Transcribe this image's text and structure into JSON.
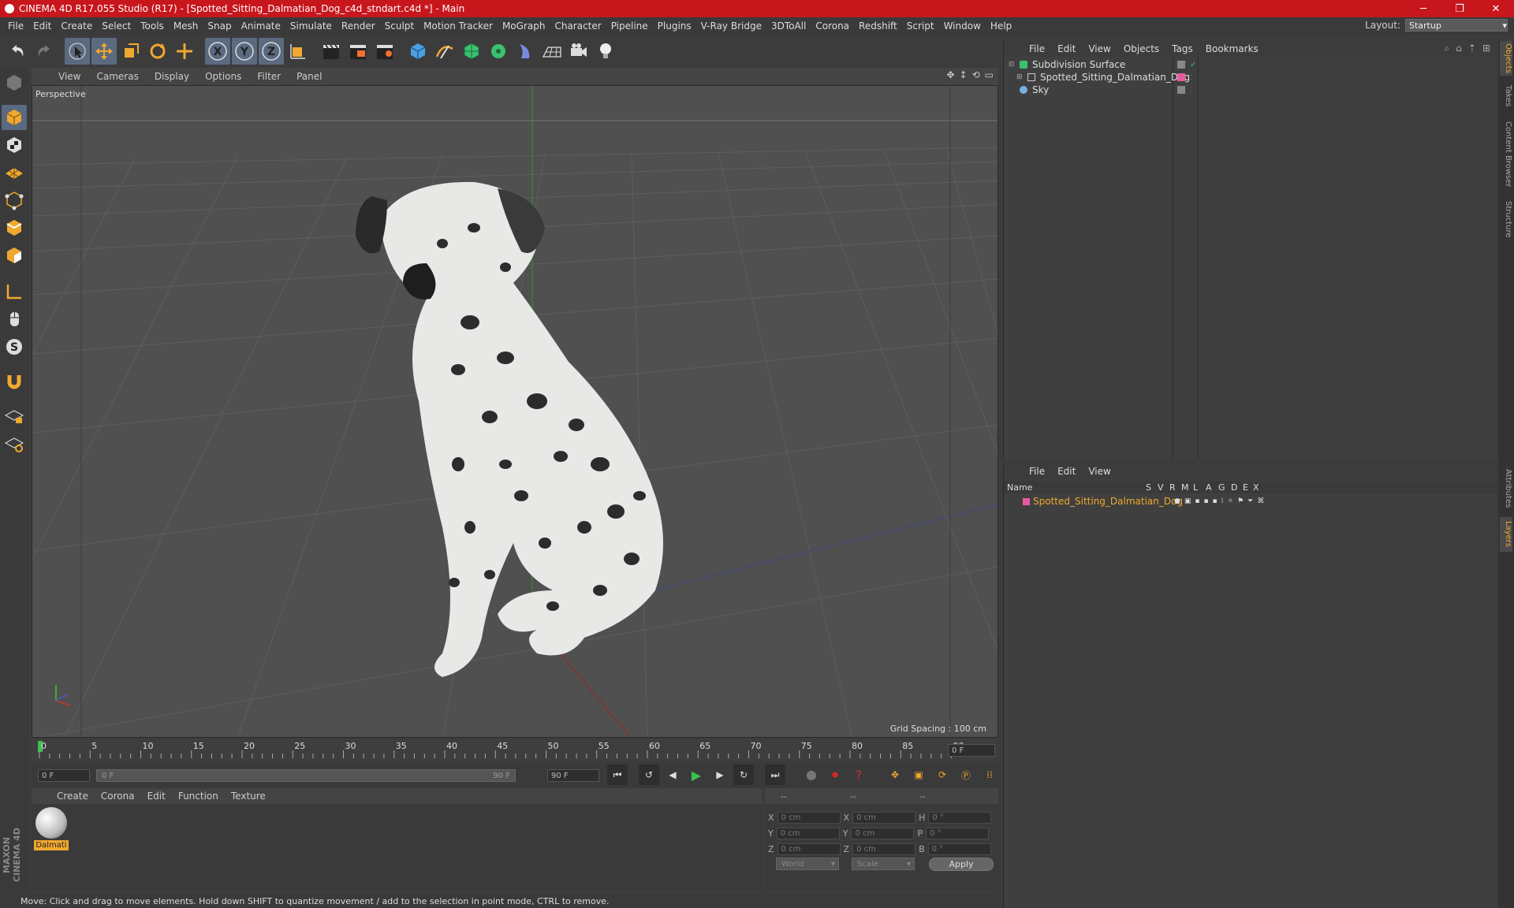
{
  "window": {
    "title": "CINEMA 4D R17.055 Studio (R17) - [Spotted_Sitting_Dalmatian_Dog_c4d_stndart.c4d *] - Main",
    "min": "─",
    "max": "❐",
    "close": "✕"
  },
  "menu": [
    "File",
    "Edit",
    "Create",
    "Select",
    "Tools",
    "Mesh",
    "Snap",
    "Animate",
    "Simulate",
    "Render",
    "Sculpt",
    "Motion Tracker",
    "MoGraph",
    "Character",
    "Pipeline",
    "Plugins",
    "V-Ray Bridge",
    "3DToAll",
    "Corona",
    "Redshift",
    "Script",
    "Window",
    "Help"
  ],
  "layout": {
    "label": "Layout:",
    "value": "Startup"
  },
  "viewport": {
    "menu": [
      "View",
      "Cameras",
      "Display",
      "Options",
      "Filter",
      "Panel"
    ],
    "label": "Perspective",
    "grid_spacing": "Grid Spacing : 100 cm"
  },
  "timeline": {
    "ticks": [
      "0",
      "5",
      "10",
      "15",
      "20",
      "25",
      "30",
      "35",
      "40",
      "45",
      "50",
      "55",
      "60",
      "65",
      "70",
      "75",
      "80",
      "85",
      "90"
    ],
    "end_field": "0 F",
    "start": "0 F",
    "range_start": "0 F",
    "range_end": "90 F",
    "max": "90 F"
  },
  "material_menu": [
    "Create",
    "Corona",
    "Edit",
    "Function",
    "Texture"
  ],
  "material": {
    "name": "Dalmati"
  },
  "coords": {
    "headers": [
      "--",
      "--",
      "--"
    ],
    "rows": [
      {
        "a": "X",
        "av": "0 cm",
        "b": "X",
        "bv": "0 cm",
        "c": "H",
        "cv": "0 °"
      },
      {
        "a": "Y",
        "av": "0 cm",
        "b": "Y",
        "bv": "0 cm",
        "c": "P",
        "cv": "0 °"
      },
      {
        "a": "Z",
        "av": "0 cm",
        "b": "Z",
        "bv": "0 cm",
        "c": "B",
        "cv": "0 °"
      }
    ],
    "world": "World",
    "scale": "Scale",
    "apply": "Apply"
  },
  "status": "Move: Click and drag to move elements. Hold down SHIFT to quantize movement / add to the selection in point mode, CTRL to remove.",
  "object_manager": {
    "menu": [
      "File",
      "Edit",
      "View",
      "Objects",
      "Tags",
      "Bookmarks"
    ],
    "objects": [
      {
        "name": "Subdivision Surface"
      },
      {
        "name": "Spotted_Sitting_Dalmatian_Dog"
      },
      {
        "name": "Sky"
      }
    ]
  },
  "layer_manager": {
    "menu": [
      "File",
      "Edit",
      "View"
    ],
    "columns": [
      "Name",
      "S",
      "V",
      "R",
      "M",
      "L",
      "A",
      "G",
      "D",
      "E",
      "X"
    ],
    "layers": [
      {
        "name": "Spotted_Sitting_Dalmatian_Dog"
      }
    ]
  },
  "right_tabs": [
    "Objects",
    "Takes",
    "Content Browser",
    "Structure",
    "Attributes",
    "Layers"
  ],
  "brand": "MAXON CINEMA 4D",
  "colors": {
    "title_bar": "#c8161d",
    "accent": "#f0a830",
    "layer_color": "#e85aa0"
  }
}
